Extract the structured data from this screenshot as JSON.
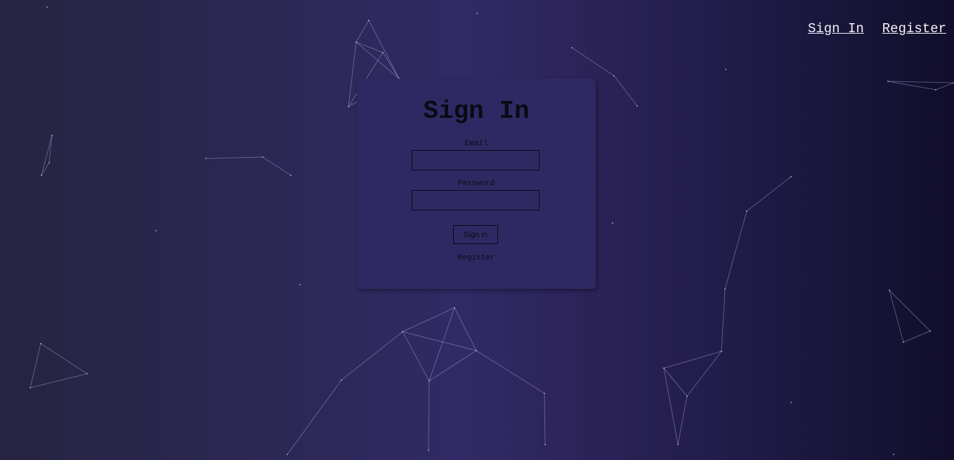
{
  "nav": {
    "sign_in": "Sign In",
    "register": "Register"
  },
  "form": {
    "title": "Sign In",
    "email_label": "Email",
    "email_value": "",
    "password_label": "Password",
    "password_value": "",
    "submit_label": "Sign in",
    "register_link": "Register"
  },
  "colors": {
    "background_left": "#262441",
    "background_center": "#312a66",
    "background_right": "#110e2b",
    "card": "#2f2963",
    "nav_text": "#f2f2f8",
    "form_text": "#0a0a14"
  }
}
